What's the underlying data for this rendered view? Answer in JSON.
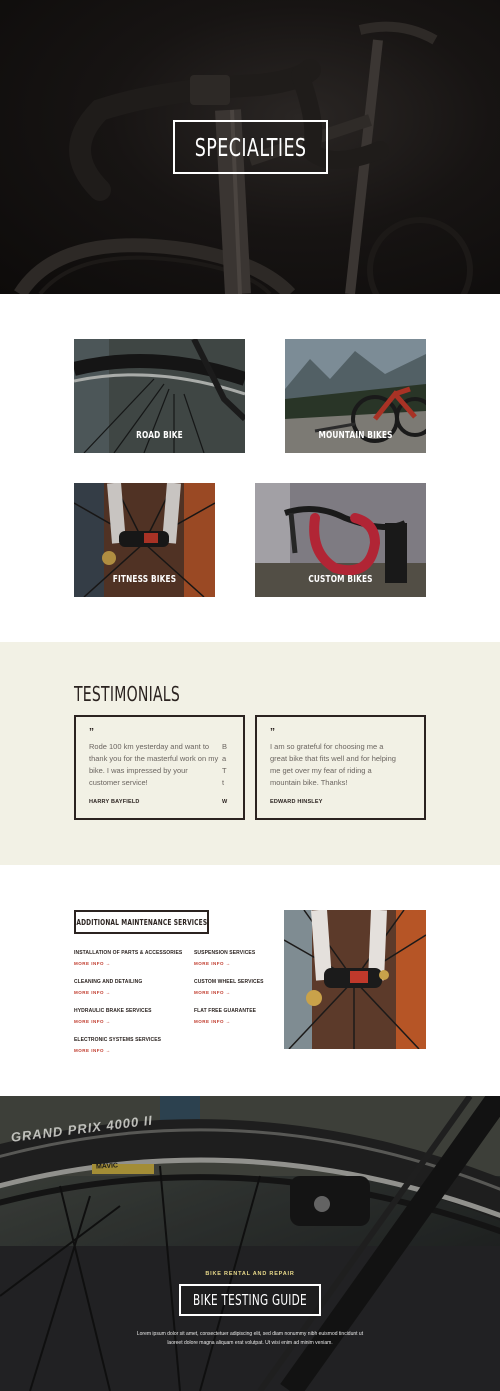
{
  "hero": {
    "title": "SPECIALTIES"
  },
  "specialties": [
    {
      "label": "ROAD BIKE"
    },
    {
      "label": "MOUNTAIN BIKES"
    },
    {
      "label": "FITNESS BIKES"
    },
    {
      "label": "CUSTOM BIKES"
    }
  ],
  "testimonials": {
    "heading": "TESTIMONIALS",
    "quote_mark": "”",
    "items": [
      {
        "text": "Rode 100 km yesterday and want to thank you for the masterful work on my bike. I was impressed by your customer service!",
        "author": "HARRY BAYFIELD"
      },
      {
        "text": "I am so grateful for choosing me a great bike that fits well and for helping me get over my fear of riding a mountain bike. Thanks!",
        "author": "EDWARD HINSLEY"
      }
    ],
    "peek_lines": [
      "B",
      "a",
      "T",
      "t"
    ],
    "peek_author": "W"
  },
  "services": {
    "heading": "ADDITIONAL MAINTENANCE SERVICES",
    "more_info": "MORE INFO →",
    "items": [
      {
        "title": "INSTALLATION OF PARTS & ACCESSORIES"
      },
      {
        "title": "SUSPENSION SERVICES"
      },
      {
        "title": "CLEANING AND DETAILING"
      },
      {
        "title": "CUSTOM WHEEL SERVICES"
      },
      {
        "title": "HYDRAULIC BRAKE SERVICES"
      },
      {
        "title": "FLAT FREE GUARANTEE"
      },
      {
        "title": "ELECTRONIC SYSTEMS SERVICES"
      }
    ]
  },
  "cta": {
    "eyebrow": "BIKE RENTAL AND REPAIR",
    "title": "BIKE TESTING GUIDE",
    "body": "Lorem ipsum dolor sit amet, consectetuer adipiscing elit, sed diam nonummy nibh euismod tincidunt ut laoreet dolore magna aliquam erat volutpat. Ut wisi enim ad minim veniam.",
    "tire_brand": "GRAND PRIX 4000 II",
    "rim_brand": "MAVIC"
  },
  "colors": {
    "accent_red": "#c0392b",
    "dark": "#2b2320",
    "cream": "#f2f1e5",
    "gold": "#e8d98a"
  }
}
